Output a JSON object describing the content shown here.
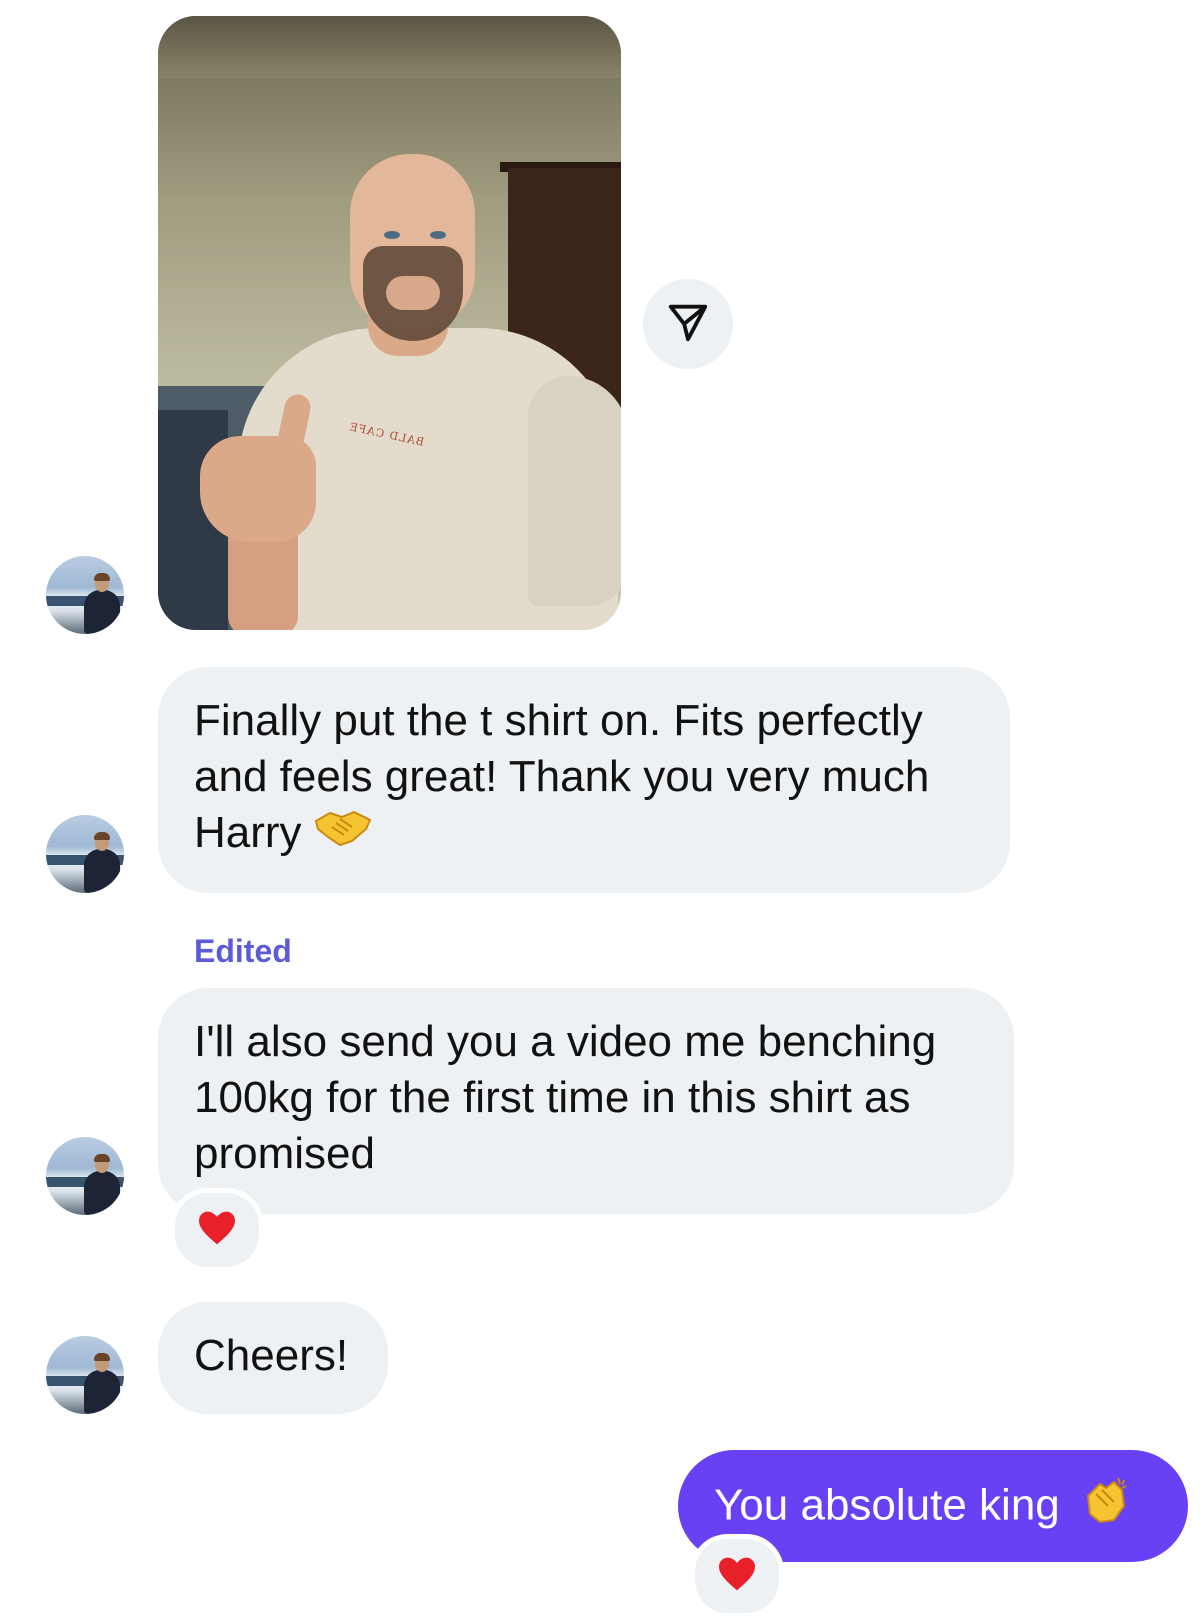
{
  "conversation": {
    "messages": [
      {
        "sender": "them",
        "type": "photo",
        "logo_text": "BALD CAFE"
      },
      {
        "sender": "them",
        "type": "text",
        "text": "Finally put the t shirt on. Fits perfectly\nand feels great! Thank you very much\nHarry",
        "emoji": "handshake-emoji"
      },
      {
        "sender": "them",
        "type": "text",
        "edited_label": "Edited",
        "text": "I'll also send you a video me benching\n100kg for the first time in this shirt as\npromised",
        "reaction": "heart-emoji"
      },
      {
        "sender": "them",
        "type": "text",
        "text": "Cheers!"
      },
      {
        "sender": "me",
        "type": "text",
        "text": "You absolute king",
        "emoji": "clapping-hands-emoji",
        "reaction": "heart-emoji"
      }
    ]
  },
  "colors": {
    "incoming_bubble": "#eef1f4",
    "outgoing_bubble": "#6841f5",
    "edited_label": "#5b5bd6",
    "reaction_heart": "#e8202a"
  }
}
